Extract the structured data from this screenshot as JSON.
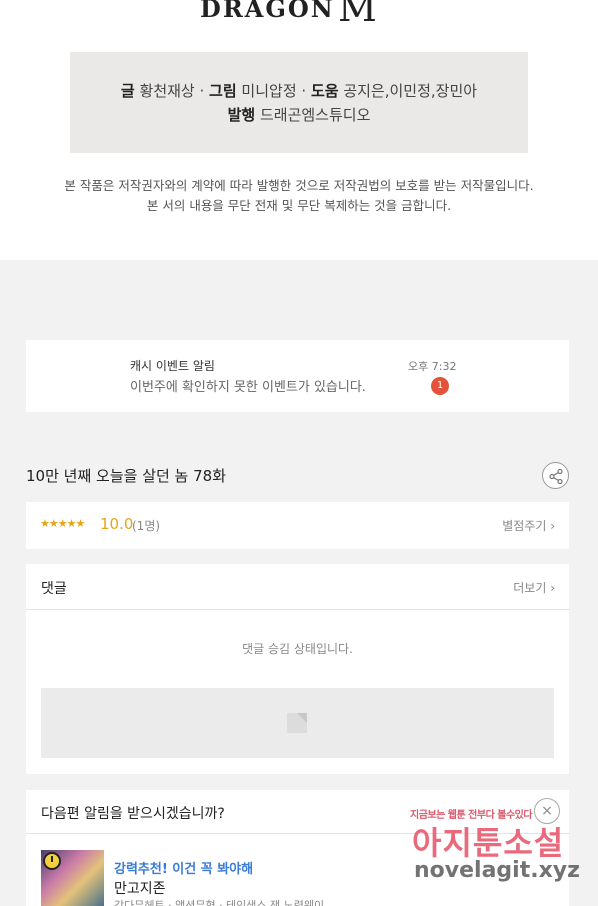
{
  "logo": {
    "word": "DRAGON",
    "mark": "M"
  },
  "credits": {
    "line1": [
      {
        "label": "글",
        "value": "황천재상"
      },
      {
        "label": "그림",
        "value": "미니압정"
      },
      {
        "label": "도움",
        "value": "공지은,이민정,장민아"
      }
    ],
    "line2": [
      {
        "label": "발행",
        "value": "드래곤엠스튜디오"
      }
    ],
    "separator": " · "
  },
  "notice": {
    "line1": "본 작품은 저작권자와의 계약에 따라 발행한 것으로 저작권법의 보호를 받는 저작물입니다.",
    "line2": "본 서의 내용을 무단 전재 및 무단 복제하는 것을 금합니다."
  },
  "alert": {
    "title": "캐시 이벤트 알림",
    "message": "이번주에 확인하지 못한 이벤트가 있습니다.",
    "time": "오후 7:32",
    "badge": "1"
  },
  "episode": {
    "title": "10만 년째 오늘을 살던 놈 78화",
    "share_icon": "share-icon"
  },
  "rating": {
    "stars": "★★★★★",
    "stars_count": 5,
    "score": "10.0",
    "count": "(1명)",
    "rate_link": "별점주기 ›"
  },
  "comments": {
    "title": "댓글",
    "more": "더보기 ›",
    "status": "댓글 승김 상태입니다."
  },
  "next_alert": {
    "title": "다음편 알림을 받으시겠습니까?",
    "close": "×",
    "promo": "강력추천! 이건 꼭 봐야해",
    "work_title": "만고지존",
    "meta": "강다무헤트 · 액션무협 · 테인생스 잭 노력웨이"
  },
  "watermark": {
    "top": "지금보는 웹툰 전부다 볼수있다",
    "main": "아지툰소설",
    "url": "novelagit.xyz"
  },
  "colors": {
    "accent": "#e8a317",
    "badge": "#e2533a",
    "link": "#3a7bd5",
    "background": "#f2f2f2"
  }
}
